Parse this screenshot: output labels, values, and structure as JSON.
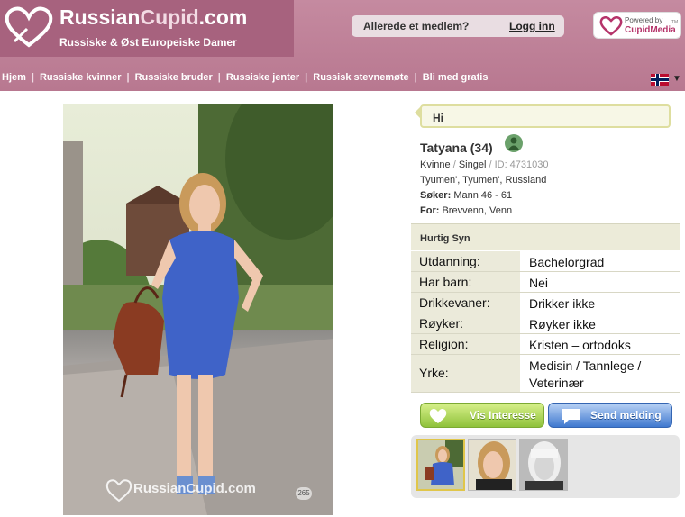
{
  "header": {
    "logo_title_a": "Russian",
    "logo_title_b": "Cupid",
    "logo_title_c": ".com",
    "logo_subtitle": "Russiske & Øst Europeiske Damer",
    "member_question": "Allerede et medlem?",
    "login_link": "Logg inn",
    "powered_by_line1": "Powered by",
    "powered_by_line2": "CupidMedia",
    "powered_by_tm": "TM"
  },
  "nav": [
    "Hjem",
    "Russiske kvinner",
    "Russiske bruder",
    "Russiske jenter",
    "Russisk stevnemøte",
    "Bli med gratis"
  ],
  "language_dropdown": "Norwegian flag",
  "photo": {
    "watermark": "RussianCupid.com",
    "count": "265"
  },
  "profile": {
    "greeting": "Hi",
    "name": "Tatyana (34)",
    "gender": "Kvinne",
    "status": "Singel",
    "id_text": "ID: 4731030",
    "location": "Tyumen', Tyumen', Russland",
    "seeking_label": "Søker:",
    "seeking_value": "Mann 46 - 61",
    "for_label": "For:",
    "for_value": "Brevvenn, Venn"
  },
  "quick_view": {
    "title": "Hurtig Syn",
    "rows": [
      {
        "label": "Utdanning:",
        "value": "Bachelorgrad"
      },
      {
        "label": "Har barn:",
        "value": "Nei"
      },
      {
        "label": "Drikkevaner:",
        "value": "Drikker ikke"
      },
      {
        "label": "Røyker:",
        "value": "Røyker ikke"
      },
      {
        "label": "Religion:",
        "value": "Kristen – ortodoks"
      },
      {
        "label": "Yrke:",
        "value": "Medisin / Tannlege / Veterinær"
      }
    ]
  },
  "buttons": {
    "interest": "Vis Interesse",
    "message": "Send melding"
  },
  "colors": {
    "brand": "#b87890",
    "logo_bg": "#a7627e",
    "interest_green": "#8fc23b",
    "message_blue": "#3f78cf"
  }
}
